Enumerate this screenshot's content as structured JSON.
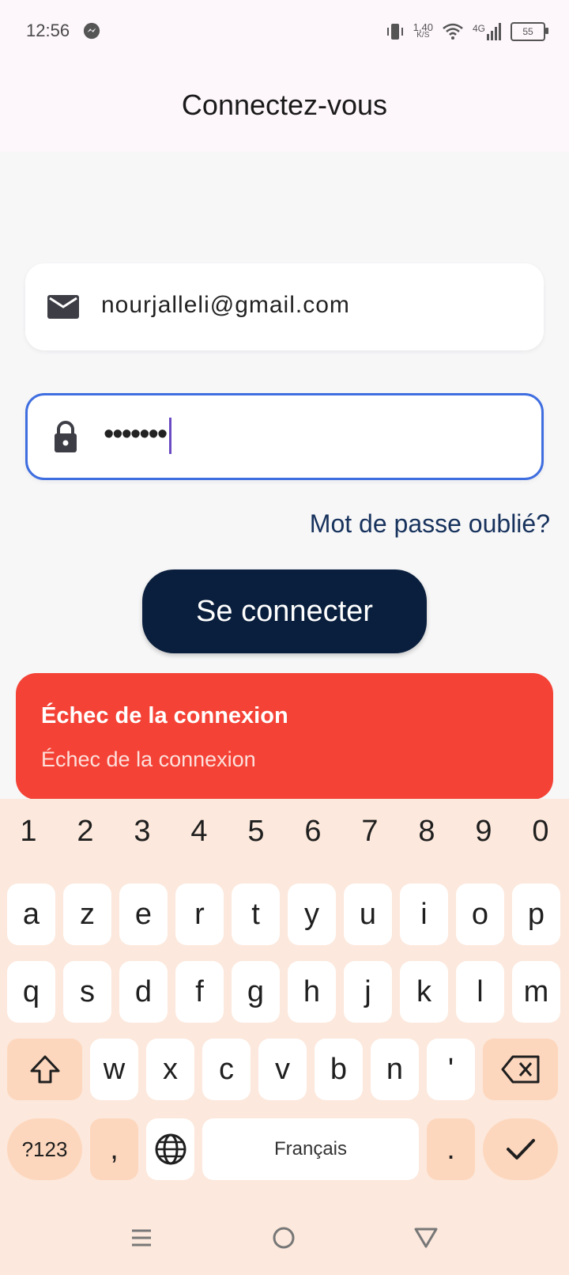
{
  "status_bar": {
    "time": "12:56",
    "net_speed": "1,40",
    "net_unit": "K/S",
    "network": "4G",
    "battery": "55"
  },
  "app_bar": {
    "title": "Connectez-vous"
  },
  "form": {
    "email_value": "nourjalleli@gmail.com",
    "password_mask": "•••••••",
    "forgot_link": "Mot de passe oublié?",
    "login_button": "Se connecter"
  },
  "snackbar": {
    "title": "Échec de la connexion",
    "message": "Échec de la connexion",
    "color": "#f44336"
  },
  "keyboard": {
    "numbers": [
      "1",
      "2",
      "3",
      "4",
      "5",
      "6",
      "7",
      "8",
      "9",
      "0"
    ],
    "row1": [
      "a",
      "z",
      "e",
      "r",
      "t",
      "y",
      "u",
      "i",
      "o",
      "p"
    ],
    "row2": [
      "q",
      "s",
      "d",
      "f",
      "g",
      "h",
      "j",
      "k",
      "l",
      "m"
    ],
    "row3": [
      "w",
      "x",
      "c",
      "v",
      "b",
      "n",
      "'"
    ],
    "symbols_key": "?123",
    "comma_key": ",",
    "space_label": "Français",
    "period_key": "."
  },
  "colors": {
    "primary_button": "#0a1f3d",
    "focus_border": "#3f6ee0",
    "keyboard_bg": "#fce8dc"
  }
}
